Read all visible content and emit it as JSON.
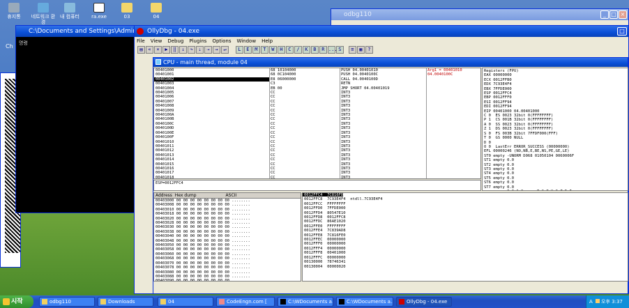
{
  "desktop": {
    "icons": [
      "휴지통",
      "네트워크 환경",
      "내 컴퓨터",
      "ra.exe",
      "03",
      "04"
    ]
  },
  "cmd_window": {
    "title": "C:\\Documents and Settings\\Administr",
    "prompt": "명령"
  },
  "side_panel_text": "Ch",
  "bg_window": {
    "title": "odbg110"
  },
  "olly": {
    "title": "OllyDbg - 04.exe",
    "menu": [
      "File",
      "View",
      "Debug",
      "Plugins",
      "Options",
      "Window",
      "Help"
    ],
    "toolbar_letters": [
      "L",
      "E",
      "M",
      "T",
      "W",
      "H",
      "C",
      "/",
      "K",
      "B",
      "R",
      "...",
      "S"
    ],
    "cpu_title": "CPU - main thread, module 04",
    "disasm_addr": [
      "00401000",
      "00401001",
      "00401002",
      "00401003",
      "00401004",
      "00401005",
      "00401006",
      "00401007",
      "00401008",
      "00401009",
      "0040100A",
      "0040100B",
      "0040100C",
      "0040100D",
      "0040100E",
      "0040100F",
      "00401010",
      "00401011",
      "00401012",
      "00401013",
      "00401014",
      "00401015",
      "00401016",
      "00401017",
      "00401018",
      "00401019",
      "0040101A",
      "0040101B",
      "0040101C",
      "0040101D",
      "0040101E",
      "0040101F",
      "00401020",
      "00401021",
      "00401022",
      "00401023",
      "00401024"
    ],
    "disasm_hex": [
      "68 10104000",
      "68 0C104000",
      "E8 06000000",
      "C3",
      "EB 00",
      "CC",
      "CC",
      "CC",
      "CC",
      "CC",
      "CC",
      "CC",
      "CC",
      "CC",
      "CC",
      "CC",
      "CC",
      "CC",
      "CC",
      "CC",
      "CC",
      "CC",
      "CC",
      "CC",
      "CC",
      "CC",
      "CC",
      "CC",
      "CC",
      "CC",
      "CC",
      "CC",
      "CC",
      "CC",
      "CC",
      "CC",
      "CC"
    ],
    "disasm_ins": [
      "PUSH 04.00401010",
      "PUSH 04.0040100C",
      "CALL 04.0040100D",
      "RETN",
      "JMP SHORT 04.00401019",
      "INT3",
      "INT3",
      "INT3",
      "INT3",
      "INT3",
      "INT3",
      "INT3",
      "INT3",
      "INT3",
      "INT3",
      "INT3",
      "INT3",
      "INT3",
      "INT3",
      "INT3",
      "INT3",
      "INT3",
      "INT3",
      "INT3",
      "INT3",
      "INT3",
      "INT3",
      "INT3",
      "INT3",
      "INT3",
      "INT3",
      "INT3",
      "INT3",
      "INT3",
      "INT3",
      "INT3",
      "INT3"
    ],
    "disasm_cmt": [
      "Arg1 = 00401010",
      "04.0040100C",
      ""
    ],
    "info_line": "ESP=0012FFC4",
    "registers": [
      "Registers (FPU)",
      "EAX 00000000",
      "ECX 0012FFB0",
      "EDX 7C93E4F4",
      "EBX 7FFDE000",
      "ESP 0012FFC4",
      "EBP 0012FFF0",
      "ESI 0012FF94",
      "EDI 0012FF94",
      "",
      "EIP 00401000 04.00401000",
      "",
      "C 0  ES 0023 32bit 0(FFFFFFFF)",
      "P 1  CS 001B 32bit 0(FFFFFFFF)",
      "A 0  SS 0023 32bit 0(FFFFFFFF)",
      "Z 1  DS 0023 32bit 0(FFFFFFFF)",
      "S 0  FS 003B 32bit 7FFDF000(FFF)",
      "T 0  GS 0000 NULL",
      "D 0",
      "O 0  LastErr ERROR_SUCCESS (00000000)",
      "",
      "EFL 00000246 (NO,NB,E,BE,NS,PE,GE,LE)",
      "",
      "ST0 empty -UNORM D068 01050104 0060006F",
      "ST1 empty 0.0",
      "ST2 empty 0.0",
      "ST3 empty 0.0",
      "ST4 empty 0.0",
      "ST5 empty 0.0",
      "ST6 empty 0.0",
      "ST7 empty 0.0",
      "          3 2 1 0      E S P U O Z D I",
      "FST 0000  Cond 0 0 0 0  Err 0 0 0 0 0 0 0 0",
      "FCW 027F  Prec NEAR,53  Mask    1 1 1 1 1 1"
    ],
    "dump_headers": [
      "Address",
      "Hex dump",
      "ASCII"
    ],
    "dump_rows": [
      "00403000 00 00 00 00 00 00 00 00 ........",
      "00403008 00 00 00 00 00 00 00 00 ........",
      "00403010 00 00 00 00 00 00 00 00 ........",
      "00403018 00 00 00 00 00 00 00 00 ........",
      "00403020 00 00 00 00 00 00 00 00 ........",
      "00403028 00 00 00 00 00 00 00 00 ........",
      "00403030 00 00 00 00 00 00 00 00 ........",
      "00403038 00 00 00 00 00 00 00 00 ........",
      "00403040 00 00 00 00 00 00 00 00 ........",
      "00403048 00 00 00 00 00 00 00 00 ........",
      "00403050 00 00 00 00 00 00 00 00 ........",
      "00403058 00 00 00 00 00 00 00 00 ........",
      "00403060 00 00 00 00 00 00 00 00 ........",
      "00403068 00 00 00 00 00 00 00 00 ........",
      "00403070 00 00 00 00 00 00 00 00 ........",
      "00403078 00 00 00 00 00 00 00 00 ........",
      "00403080 00 00 00 00 00 00 00 00 ........",
      "00403088 00 00 00 00 00 00 00 00 ........",
      "00403090 00 00 00 00 00 00 00 00 ........"
    ],
    "stack_rows": [
      "0012FFC4  7C816FD7  RETURN to kernel32.7C816FD7",
      "0012FFC8  7C93E4F4  ntdll.7C93E4F4",
      "0012FFCC  FFFFFFFF",
      "0012FFD0  7FFDE000",
      "0012FFD4  80547E10",
      "0012FFD8  0012FFC8",
      "0012FFDC  86AE1020",
      "0012FFE0  FFFFFFFF",
      "0012FFE4  7C839AD8",
      "0012FFE8  7C816FE0",
      "0012FFEC  00000000",
      "0012FFF0  00000000",
      "0012FFF4  00000000",
      "0012FFF8  00401000",
      "0012FFFC  00000000",
      "00130000  78746341",
      "00130004  00000020"
    ]
  },
  "taskbar": {
    "start": "시작",
    "items": [
      "odbg110",
      "Downloads",
      "04",
      "CodeEngn.com [",
      "C:\\WDocuments a...",
      "C:\\WDocuments a...",
      "OllyDbg - 04.exe"
    ],
    "clock": "오후 3:37",
    "lang": "A"
  },
  "colors": {
    "titlebar": "#0a4fd6",
    "desktop_sky": "#3e73c4",
    "highlight": "#c00000"
  }
}
